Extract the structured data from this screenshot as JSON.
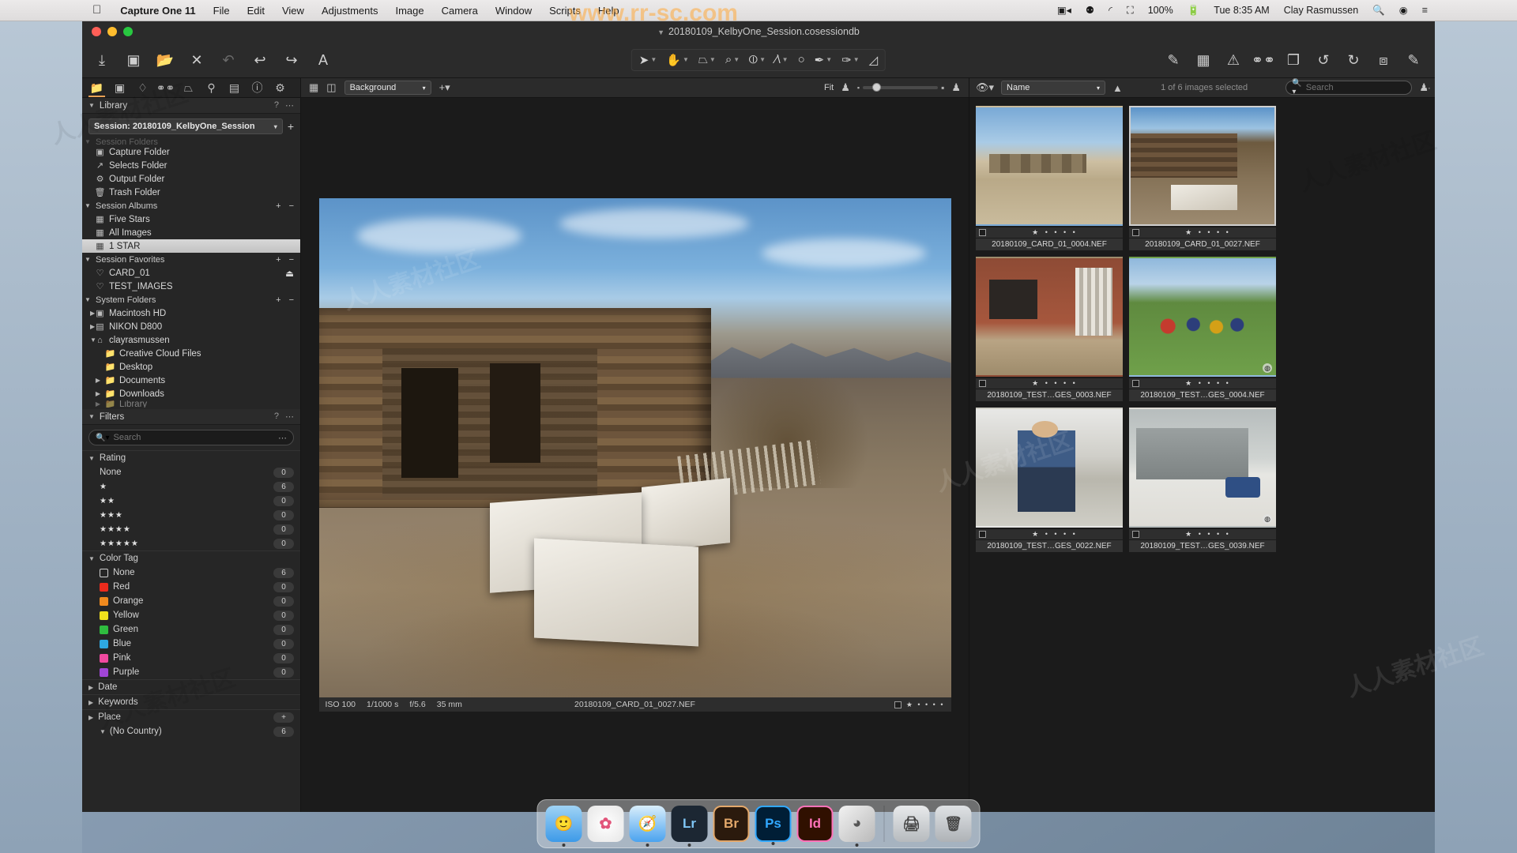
{
  "menubar": {
    "apple": "",
    "app_name": "Capture One 11",
    "items": [
      "File",
      "Edit",
      "View",
      "Adjustments",
      "Image",
      "Camera",
      "Window",
      "Scripts",
      "Help"
    ],
    "status": {
      "screen_record_icon": "video-camera-icon",
      "creative_cloud_icon": "creative-cloud-icon",
      "wifi_icon": "wifi-icon",
      "airplay_icon": "airplay-icon",
      "battery_percent": "100%",
      "battery_icon": "battery-charging-icon",
      "time": "Tue 8:35 AM",
      "user": "Clay Rasmussen",
      "search_icon": "spotlight-search-icon",
      "siri_icon": "siri-icon",
      "notification_icon": "notification-center-icon"
    }
  },
  "window": {
    "title": "20180109_KelbyOne_Session.cosessiondb",
    "title_prefix_icon": "document-proxy-icon"
  },
  "toolbar": {
    "left_tools": [
      {
        "name": "import-images-icon",
        "glyph": "⤓"
      },
      {
        "name": "capture-icon",
        "glyph": "▣"
      },
      {
        "name": "export-images-icon",
        "glyph": "🗀"
      },
      {
        "name": "delete-icon",
        "glyph": "✕"
      },
      {
        "name": "undo-all-icon",
        "glyph": "↺"
      },
      {
        "name": "undo-icon",
        "glyph": "↩"
      },
      {
        "name": "redo-icon",
        "glyph": "↪"
      },
      {
        "name": "annotation-text-icon",
        "glyph": "A"
      }
    ],
    "center_tools": [
      {
        "name": "select-cursor-tool",
        "glyph": "➤"
      },
      {
        "name": "pan-hand-tool",
        "glyph": "✋"
      },
      {
        "name": "crop-mask-tool",
        "glyph": "⌂"
      },
      {
        "name": "crop-tool",
        "glyph": "⌗"
      },
      {
        "name": "rotate-tool",
        "glyph": "⦶"
      },
      {
        "name": "keystone-tool",
        "glyph": "/\\"
      },
      {
        "name": "spot-removal-tool",
        "glyph": "◯"
      },
      {
        "name": "draw-mask-tool",
        "glyph": "✎"
      },
      {
        "name": "erase-mask-tool",
        "glyph": "✐"
      },
      {
        "name": "gradient-mask-tool",
        "glyph": "◣"
      }
    ],
    "right_tools": [
      {
        "name": "edit-with-icon",
        "glyph": "✎"
      },
      {
        "name": "grid-overlay-icon",
        "glyph": "▦"
      },
      {
        "name": "exposure-warning-icon",
        "glyph": "⚠"
      },
      {
        "name": "focus-mask-icon",
        "glyph": "👓"
      },
      {
        "name": "duplicate-variant-icon",
        "glyph": "❐"
      },
      {
        "name": "rotate-left-icon",
        "glyph": "↺"
      },
      {
        "name": "rotate-right-icon",
        "glyph": "↻"
      },
      {
        "name": "fullscreen-icon",
        "glyph": "⤢"
      },
      {
        "name": "customize-toolbar-icon",
        "glyph": "✎"
      }
    ]
  },
  "sidebar": {
    "tool_tabs": [
      {
        "name": "library-tab",
        "glyph": "🗀",
        "active": true
      },
      {
        "name": "capture-tab",
        "glyph": "▣",
        "active": false
      },
      {
        "name": "lens-tab",
        "glyph": "◊",
        "active": false
      },
      {
        "name": "color-tab",
        "glyph": "⚭",
        "active": false
      },
      {
        "name": "exposure-tab",
        "glyph": "⌂",
        "active": false
      },
      {
        "name": "details-tab",
        "glyph": "🔍",
        "active": false
      },
      {
        "name": "adjustments-tab",
        "glyph": "▤",
        "active": false
      },
      {
        "name": "metadata-tab",
        "glyph": "ⓘ",
        "active": false
      },
      {
        "name": "output-tab",
        "glyph": "⚙",
        "active": false
      }
    ],
    "library_panel": {
      "title": "Library",
      "help_glyph": "?",
      "menu_glyph": "⋯",
      "session_label": "Session: 20180109_KelbyOne_Session",
      "add_glyph": "+"
    },
    "session_folders": {
      "group": "Session Folders",
      "items": [
        {
          "label": "Capture Folder",
          "icon": "camera-icon"
        },
        {
          "label": "Selects Folder",
          "icon": "selects-folder-icon"
        },
        {
          "label": "Output Folder",
          "icon": "gear-icon"
        },
        {
          "label": "Trash Folder",
          "icon": "trash-icon"
        }
      ]
    },
    "session_albums": {
      "group": "Session Albums",
      "add_glyph": "+",
      "remove_glyph": "−",
      "items": [
        {
          "label": "Five Stars",
          "icon": "album-icon",
          "selected": false
        },
        {
          "label": "All Images",
          "icon": "album-icon",
          "selected": false
        },
        {
          "label": "1 STAR",
          "icon": "smart-album-icon",
          "selected": true
        }
      ]
    },
    "session_favorites": {
      "group": "Session Favorites",
      "add_glyph": "+",
      "remove_glyph": "−",
      "items": [
        {
          "label": "CARD_01",
          "icon": "heart-icon",
          "trailing_icon": "eject-icon"
        },
        {
          "label": "TEST_IMAGES",
          "icon": "heart-icon",
          "trailing_icon": ""
        }
      ]
    },
    "system_folders": {
      "group": "System Folders",
      "add_glyph": "+",
      "remove_glyph": "−",
      "items": [
        {
          "label": "Macintosh HD",
          "icon": "hard-drive-icon",
          "disclosure": "collapsed",
          "indent": 1
        },
        {
          "label": "NIKON D800",
          "icon": "hard-drive-icon",
          "disclosure": "collapsed",
          "indent": 1
        },
        {
          "label": "clayrasmussen",
          "icon": "home-folder-icon",
          "disclosure": "expanded",
          "indent": 1
        },
        {
          "label": "Creative Cloud Files",
          "icon": "folder-icon",
          "disclosure": "none",
          "indent": 2
        },
        {
          "label": "Desktop",
          "icon": "folder-icon",
          "disclosure": "none",
          "indent": 2
        },
        {
          "label": "Documents",
          "icon": "folder-icon",
          "disclosure": "collapsed",
          "indent": 2
        },
        {
          "label": "Downloads",
          "icon": "folder-icon",
          "disclosure": "collapsed",
          "indent": 2
        },
        {
          "label": "Library",
          "icon": "folder-icon",
          "disclosure": "collapsed",
          "indent": 2
        }
      ]
    },
    "filters_panel": {
      "title": "Filters",
      "help_glyph": "?",
      "menu_glyph": "⋯",
      "search_placeholder": "Search",
      "search_value": "",
      "rating": {
        "group": "Rating",
        "items": [
          {
            "label": "None",
            "stars": 0,
            "count": "0"
          },
          {
            "label": "★",
            "stars": 1,
            "count": "6"
          },
          {
            "label": "★★",
            "stars": 2,
            "count": "0"
          },
          {
            "label": "★★★",
            "stars": 3,
            "count": "0"
          },
          {
            "label": "★★★★",
            "stars": 4,
            "count": "0"
          },
          {
            "label": "★★★★★",
            "stars": 5,
            "count": "0"
          }
        ]
      },
      "color_tag": {
        "group": "Color Tag",
        "items": [
          {
            "label": "None",
            "color": "none",
            "count": "6"
          },
          {
            "label": "Red",
            "color": "#ed2b1c",
            "count": "0"
          },
          {
            "label": "Orange",
            "color": "#f08a1e",
            "count": "0"
          },
          {
            "label": "Yellow",
            "color": "#f2e11c",
            "count": "0"
          },
          {
            "label": "Green",
            "color": "#2fbd3f",
            "count": "0"
          },
          {
            "label": "Blue",
            "color": "#2ea8e0",
            "count": "0"
          },
          {
            "label": "Pink",
            "color": "#f049a0",
            "count": "0"
          },
          {
            "label": "Purple",
            "color": "#a145d6",
            "count": "0"
          }
        ]
      },
      "collapsed_groups": [
        {
          "label": "Date"
        },
        {
          "label": "Keywords"
        }
      ],
      "place": {
        "group": "Place",
        "items": [
          {
            "label": "(No Country)",
            "count": "6"
          }
        ]
      }
    }
  },
  "viewer": {
    "bar": {
      "grid_view_icon": "grid-view-icon",
      "split_view_icon": "split-view-icon",
      "layer_select_value": "Background",
      "add_layer_icon": "add-layer-icon",
      "fit_label": "Fit",
      "proof_icon": "proof-profile-icon",
      "zoom_min": "▪",
      "zoom_max": "▪",
      "zoom_position_percent": 14,
      "person_icon": "user-icon"
    },
    "photo": {
      "iso": "ISO 100",
      "shutter": "1/1000 s",
      "aperture": "f/5.6",
      "focal": "35 mm",
      "filename": "20180109_CARD_01_0027.NEF",
      "rating_stars": 1,
      "rating_display": "★ • • • •"
    }
  },
  "browser": {
    "bar": {
      "eye_icon": "visibility-icon",
      "sort_value": "Name",
      "sort_direction_icon": "sort-ascending-icon",
      "status": "1 of 6 images selected",
      "search_placeholder": "Search",
      "search_value": "",
      "search_options_icon": "ellipsis-icon",
      "person_icon": "user-icon"
    },
    "thumbnails": [
      {
        "filename": "20180109_CARD_01_0004.NEF",
        "rating": "★ • • • •",
        "selected": false,
        "art": "t1",
        "corner_badge": ""
      },
      {
        "filename": "20180109_CARD_01_0027.NEF",
        "rating": "★ • • • •",
        "selected": true,
        "art": "t2",
        "corner_badge": ""
      },
      {
        "filename": "20180109_TEST…GES_0003.NEF",
        "rating": "★ • • • •",
        "selected": false,
        "art": "t3",
        "corner_badge": ""
      },
      {
        "filename": "20180109_TEST…GES_0004.NEF",
        "rating": "★ • • • •",
        "selected": false,
        "art": "t4",
        "corner_badge": "◍"
      },
      {
        "filename": "20180109_TEST…GES_0022.NEF",
        "rating": "★ • • • •",
        "selected": false,
        "art": "t5",
        "corner_badge": ""
      },
      {
        "filename": "20180109_TEST…GES_0039.NEF",
        "rating": "★ • • • •",
        "selected": false,
        "art": "t6",
        "corner_badge": "◍"
      }
    ]
  },
  "dock": {
    "items": [
      {
        "name": "finder",
        "label": "🙂",
        "color": "#3d9ae8",
        "running": true
      },
      {
        "name": "photos",
        "label": "✿",
        "color": "#f0f0f0",
        "running": false
      },
      {
        "name": "safari",
        "label": "🧭",
        "color": "#4aa3ef",
        "running": true
      },
      {
        "name": "lightroom",
        "label": "Lr",
        "color": "#1c2733",
        "running": true
      },
      {
        "name": "bridge",
        "label": "Br",
        "color": "#2b1a0d",
        "running": false
      },
      {
        "name": "photoshop",
        "label": "Ps",
        "color": "#001e36",
        "running": true
      },
      {
        "name": "indesign",
        "label": "Id",
        "color": "#301000",
        "running": false
      },
      {
        "name": "capture-one",
        "label": "◕",
        "color": "#d8d8d8",
        "running": true
      },
      {
        "name": "separator",
        "label": "",
        "color": "",
        "running": false
      },
      {
        "name": "scanner",
        "label": "🖨",
        "color": "#c8ccd0",
        "running": false
      },
      {
        "name": "trash",
        "label": "🗑",
        "color": "#b8bcc0",
        "running": false
      }
    ]
  },
  "watermark": {
    "url": "www.rr-sc.com",
    "text": "人人素材社区"
  }
}
